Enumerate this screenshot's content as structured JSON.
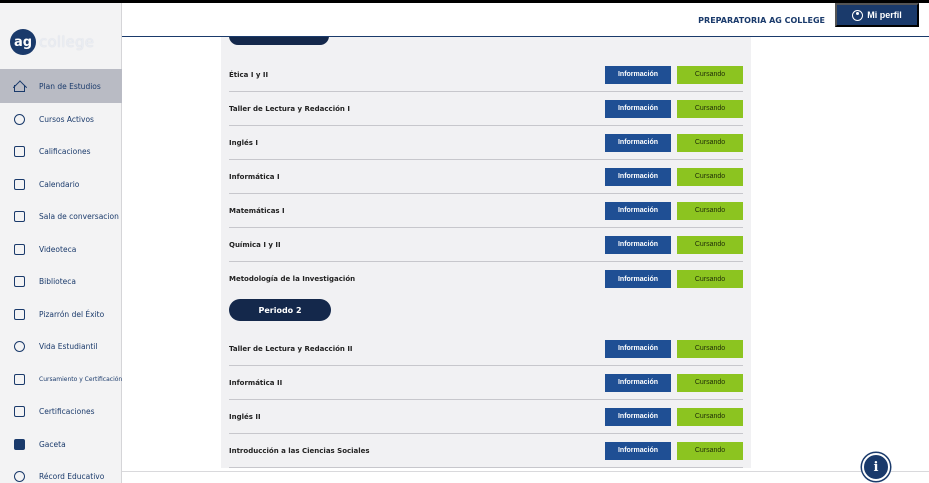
{
  "brand": {
    "logo_mark": "ag",
    "logo_word": "college"
  },
  "header": {
    "school": "PREPARATORIA AG COLLEGE",
    "profile_label": "Mi perfil",
    "profile_icon": "user-circle-icon"
  },
  "sidebar": {
    "items": [
      {
        "label": "Plan de Estudios",
        "icon": "home-icon",
        "active": true
      },
      {
        "label": "Cursos Activos",
        "icon": "user-group-icon"
      },
      {
        "label": "Calificaciones",
        "icon": "clipboard-icon"
      },
      {
        "label": "Calendario",
        "icon": "calendar-icon"
      },
      {
        "label": "Sala de conversacion",
        "icon": "chat-icon"
      },
      {
        "label": "Videoteca",
        "icon": "video-icon"
      },
      {
        "label": "Biblioteca",
        "icon": "book-icon"
      },
      {
        "label": "Pizarrón del Éxito",
        "icon": "board-icon"
      },
      {
        "label": "Vida Estudiantil",
        "icon": "student-icon"
      },
      {
        "label": "Cursamiento y Certificación",
        "icon": "certificate-icon"
      },
      {
        "label": "Certificaciones",
        "icon": "document-icon"
      },
      {
        "label": "Gaceta",
        "icon": "newspaper-icon"
      },
      {
        "label": "Récord Educativo",
        "icon": "medal-icon"
      }
    ]
  },
  "main": {
    "period2_label": "Periodo 2",
    "info_label": "Información",
    "status_label": "Cursando",
    "period1_subjects": [
      "Ética I y II",
      "Taller de Lectura y Redacción I",
      "Inglés I",
      "Informática I",
      "Matemáticas I",
      "Química I y II",
      "Metodología de la Investigación"
    ],
    "period2_subjects": [
      "Taller de Lectura y Redacción II",
      "Informática II",
      "Inglés II",
      "Introducción a las Ciencias Sociales"
    ]
  },
  "colors": {
    "navy": "#1a3a6b",
    "info_button": "#1f4f94",
    "status_button": "#8cc420",
    "panel": "#f1f1f3"
  },
  "fab_icon": "info-icon"
}
